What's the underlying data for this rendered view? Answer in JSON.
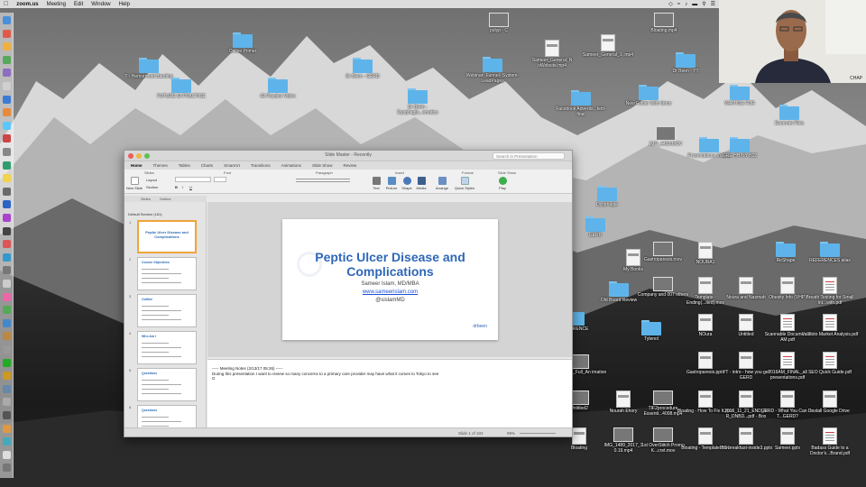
{
  "menubar": {
    "app_name": "zoom.us",
    "items": [
      "Meeting",
      "Edit",
      "Window",
      "Help"
    ]
  },
  "webcam": {
    "label": "CHAP"
  },
  "desktop_icons": [
    {
      "label": "polyp - C",
      "kind": "thumb"
    },
    {
      "label": "Bloating.mp4",
      "kind": "thumb"
    },
    {
      "label": "Online Primer",
      "kind": "folder"
    },
    {
      "label": "Sameer_General_N oWebsite.mp4",
      "kind": "doc"
    },
    {
      "label": "Sameer_General_1 .mp4",
      "kind": "doc"
    },
    {
      "label": "T - Hemorrhoid Banding",
      "kind": "folder"
    },
    {
      "label": "Dr Been - GERD",
      "kind": "folder"
    },
    {
      "label": "Webinar- Funnel- System-LeadPages",
      "kind": "folder"
    },
    {
      "label": "Dr Been - YT",
      "kind": "folder"
    },
    {
      "label": "FUTURE GI PRACTICE",
      "kind": "folder"
    },
    {
      "label": "GI Practice Video",
      "kind": "folder"
    },
    {
      "label": "Dr Been - Dysphagia...ematics",
      "kind": "folder"
    },
    {
      "label": "Facebook Advertis...tem-final",
      "kind": "folder"
    },
    {
      "label": "New Folder With Items",
      "kind": "folder"
    },
    {
      "label": "WAITING FOR",
      "kind": "folder"
    },
    {
      "label": "Evernote Files",
      "kind": "folder"
    },
    {
      "label": "Dysphagia",
      "kind": "folder"
    },
    {
      "label": "GERD",
      "kind": "folder"
    },
    {
      "label": "Gastroparesis.mov",
      "kind": "thumb"
    },
    {
      "label": "NOURA1",
      "kind": "doc"
    },
    {
      "label": "ReShape",
      "kind": "folder"
    },
    {
      "label": "REFERENCES alias",
      "kind": "folder"
    },
    {
      "label": "My Books",
      "kind": "doc"
    },
    {
      "label": "Old Board Review",
      "kind": "folder"
    },
    {
      "label": "Company and 007 others",
      "kind": "thumb"
    },
    {
      "label": "Template - Ending(...ited).mov",
      "kind": "doc"
    },
    {
      "label": "Noura and Nasmah",
      "kind": "doc"
    },
    {
      "label": "Obesity Info (VHP)",
      "kind": "doc"
    },
    {
      "label": "Breath Testing for Small Int...with.pdf",
      "kind": "pdf"
    },
    {
      "label": "REFERENCE",
      "kind": "folder"
    },
    {
      "label": "Tylenol",
      "kind": "folder"
    },
    {
      "label": "NOura",
      "kind": "doc"
    },
    {
      "label": "Untitled",
      "kind": "doc"
    },
    {
      "label": "Scannable Docume...7 AM.pdf",
      "kind": "pdf"
    },
    {
      "label": "Validoto Market Analysis.pdf",
      "kind": "pdf"
    },
    {
      "label": "OverStitch_Full_An imation",
      "kind": "thumb"
    },
    {
      "label": "Gastroparesis.pptx",
      "kind": "doc"
    },
    {
      "label": "YT - intro - how you get GERD",
      "kind": "doc"
    },
    {
      "label": "2016AM_FINAL_all presentations.pdf",
      "kind": "pdf"
    },
    {
      "label": "SEO Quick Guide.pdf",
      "kind": "pdf"
    },
    {
      "label": "Untitled2",
      "kind": "thumb"
    },
    {
      "label": "Nourah Ehory",
      "kind": "doc"
    },
    {
      "label": "TIF2procedure Essenti...4008.mp4",
      "kind": "thumb"
    },
    {
      "label": "Bloating - How To Fix It.pptx",
      "kind": "doc"
    },
    {
      "label": "2016_11_21_END_M R_DNBD...pdf - Box",
      "kind": "doc"
    },
    {
      "label": "GERD - What You Can Do T...GERD?",
      "kind": "doc"
    },
    {
      "label": "Install Google Drive",
      "kind": "doc"
    },
    {
      "label": "Bloating",
      "kind": "doc"
    },
    {
      "label": "IMG_1489_2017_1 0.19.mp4",
      "kind": "thumb"
    },
    {
      "label": "1st OverStitch Promo K...cret.mov",
      "kind": "thumb"
    },
    {
      "label": "Bloating - Template.mov",
      "kind": "doc"
    },
    {
      "label": "IBS breakfast-inside3.pptx",
      "kind": "doc"
    },
    {
      "label": "Sameer.pptx",
      "kind": "doc"
    },
    {
      "label": "Badass Guide to a Doctor's...Brand.pdf",
      "kind": "pdf"
    },
    {
      "label": "IMG_4433.MOV",
      "kind": "thumb"
    },
    {
      "label": "Presentations Videos",
      "kind": "folder"
    },
    {
      "label": "GRE HH-NY-B12",
      "kind": "folder"
    }
  ],
  "powerpoint": {
    "title": "Slide Master - Recently",
    "search_placeholder": "Search in Presentation",
    "tabs": [
      "Home",
      "Themes",
      "Tables",
      "Charts",
      "SmartArt",
      "Transitions",
      "Animations",
      "Slide Show",
      "Review"
    ],
    "ribbon_groups": [
      "Slides",
      "Font",
      "Paragraph",
      "Insert",
      "Format",
      "Slide Show"
    ],
    "ribbon_buttons": [
      "New Slide",
      "Layout",
      "Section",
      "Text",
      "Picture",
      "Shape",
      "Media",
      "Arrange",
      "Quick Styles",
      "Play"
    ],
    "zoom": "99%",
    "panel_tabs": [
      "Slides",
      "Outline"
    ],
    "section_label": "Default Section (181)",
    "thumbnails": [
      {
        "num": "1",
        "title": "Peptic Ulcer Disease and Complications"
      },
      {
        "num": "2",
        "title": "Course Objectives"
      },
      {
        "num": "3",
        "title": "Outline"
      },
      {
        "num": "4",
        "title": "Who Am I"
      },
      {
        "num": "5",
        "title": "Questions"
      },
      {
        "num": "6",
        "title": "Questions"
      }
    ],
    "slide": {
      "title": "Peptic Ulcer Disease and Complications",
      "author": "Sameer Islam, MD/MBA",
      "url": "www.sameerislam.com",
      "handle": "@sislamMD",
      "logo": "drbeen"
    },
    "notes": {
      "header": "----- Meeting Notes (2/13/17 05:26) -----",
      "line1": "During this presentation I want to review so many concerns to a primary care provider may have what it comes to Tokyo to see",
      "line2": "G"
    },
    "status": {
      "slide_count": "Slide 1 of 103",
      "zoom": "99%"
    }
  },
  "colors": {
    "slide_title": "#2e67b8",
    "folder": "#5eb4ea",
    "selection": "#f0a43a"
  }
}
